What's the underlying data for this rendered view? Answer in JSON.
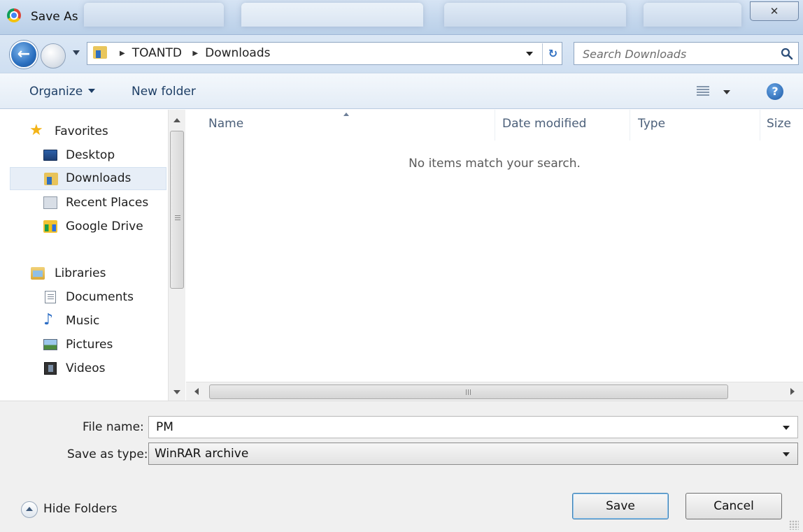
{
  "window": {
    "title": "Save As",
    "close_glyph": "✕",
    "app_icon": "chrome-icon"
  },
  "address": {
    "breadcrumbs": [
      "TOANTD",
      "Downloads"
    ],
    "search_placeholder": "Search Downloads",
    "refresh_glyph": "↻"
  },
  "toolbar": {
    "organize_label": "Organize",
    "new_folder_label": "New folder",
    "help_glyph": "?"
  },
  "nav": {
    "favorites": {
      "label": "Favorites",
      "items": [
        {
          "label": "Desktop",
          "icon": "desktop-icon"
        },
        {
          "label": "Downloads",
          "icon": "downloads-icon",
          "selected": true
        },
        {
          "label": "Recent Places",
          "icon": "recent-places-icon"
        },
        {
          "label": "Google Drive",
          "icon": "google-drive-icon"
        }
      ]
    },
    "libraries": {
      "label": "Libraries",
      "items": [
        {
          "label": "Documents",
          "icon": "documents-icon"
        },
        {
          "label": "Music",
          "icon": "music-icon"
        },
        {
          "label": "Pictures",
          "icon": "pictures-icon"
        },
        {
          "label": "Videos",
          "icon": "videos-icon"
        }
      ]
    }
  },
  "filelist": {
    "columns": [
      "Name",
      "Date modified",
      "Type",
      "Size"
    ],
    "empty_message": "No items match your search."
  },
  "form": {
    "file_name_label": "File name:",
    "file_name_value": "PM",
    "save_type_label": "Save as type:",
    "save_type_value": "WinRAR archive"
  },
  "footer": {
    "hide_folders_label": "Hide Folders",
    "save_label": "Save",
    "cancel_label": "Cancel"
  },
  "colors": {
    "titlebar": "#c3d6ec",
    "toolbar_text": "#1e3f66",
    "selected_nav": "#e7eef7",
    "column_header_text": "#4c607a"
  }
}
